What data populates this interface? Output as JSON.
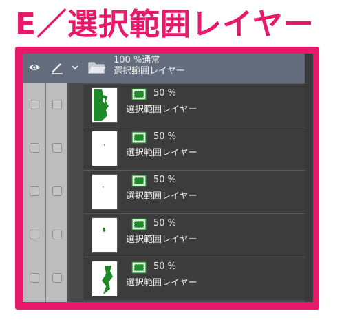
{
  "title": "E／選択範囲レイヤー",
  "colors": {
    "accent": "#e8186b",
    "panel_bg": "#4a4a4a",
    "header_bg": "#646d7e",
    "selection_green": "#1e8a2a"
  },
  "folder": {
    "opacity_mode": "100 %通常",
    "name": "選択範囲レイヤー",
    "icons": [
      "eye-icon",
      "pen-icon",
      "chevron-down-icon",
      "folder-icon"
    ]
  },
  "layers": [
    {
      "opacity": "50 %",
      "name": "選択範囲レイヤー",
      "thumb": "large-shape"
    },
    {
      "opacity": "50 %",
      "name": "選択範囲レイヤー",
      "thumb": "tiny-mark"
    },
    {
      "opacity": "50 %",
      "name": "選択範囲レイヤー",
      "thumb": "tiny-mark"
    },
    {
      "opacity": "50 %",
      "name": "選択範囲レイヤー",
      "thumb": "small-mark"
    },
    {
      "opacity": "50 %",
      "name": "選択範囲レイヤー",
      "thumb": "medium-shape"
    }
  ]
}
